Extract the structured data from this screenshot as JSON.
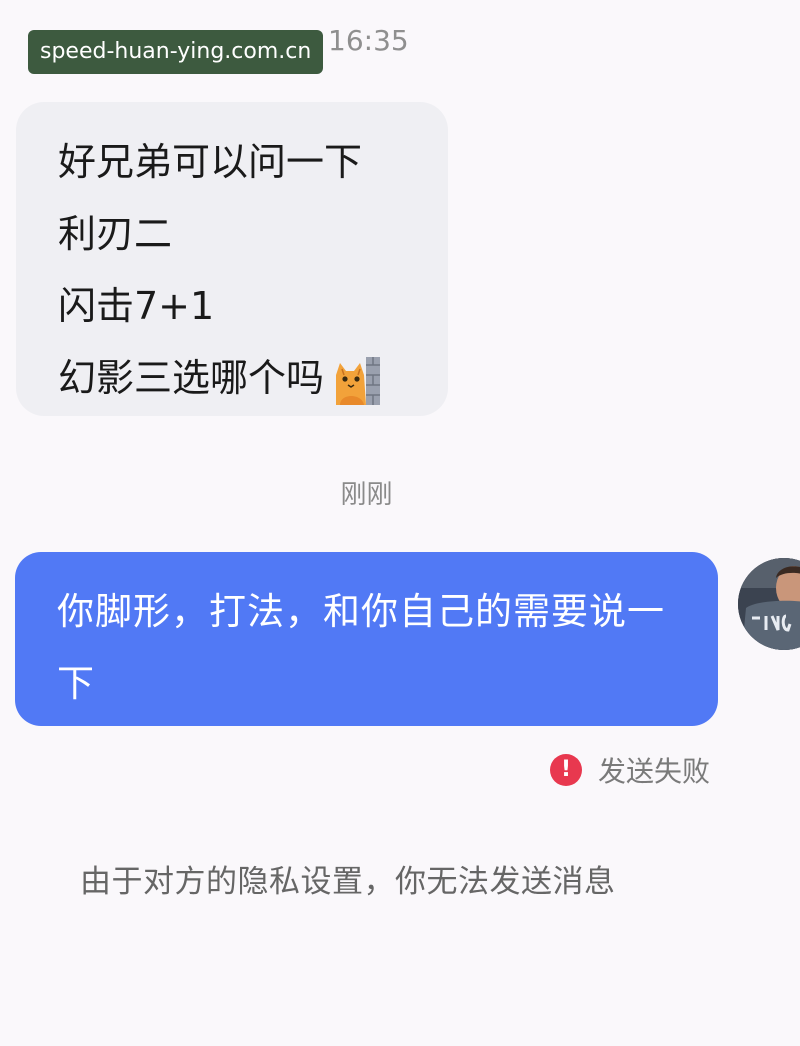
{
  "watermark": {
    "text": "speed-huan-ying.com.cn"
  },
  "header": {
    "time": "16:35"
  },
  "incoming_message": {
    "lines": [
      "好兄弟可以问一下",
      "利刃二",
      "闪击7+1",
      "幻影三选哪个吗"
    ],
    "emoji": "cat-peeking-icon"
  },
  "divider": {
    "time": "刚刚"
  },
  "outgoing_message": {
    "text": "你脚形，打法，和你自己的需要说一下",
    "status": "发送失败",
    "status_icon": "exclamation-icon",
    "bubble_color": "#5179f5",
    "status_color": "#e8384f"
  },
  "notice": {
    "text": "由于对方的隐私设置，你无法发送消息"
  }
}
